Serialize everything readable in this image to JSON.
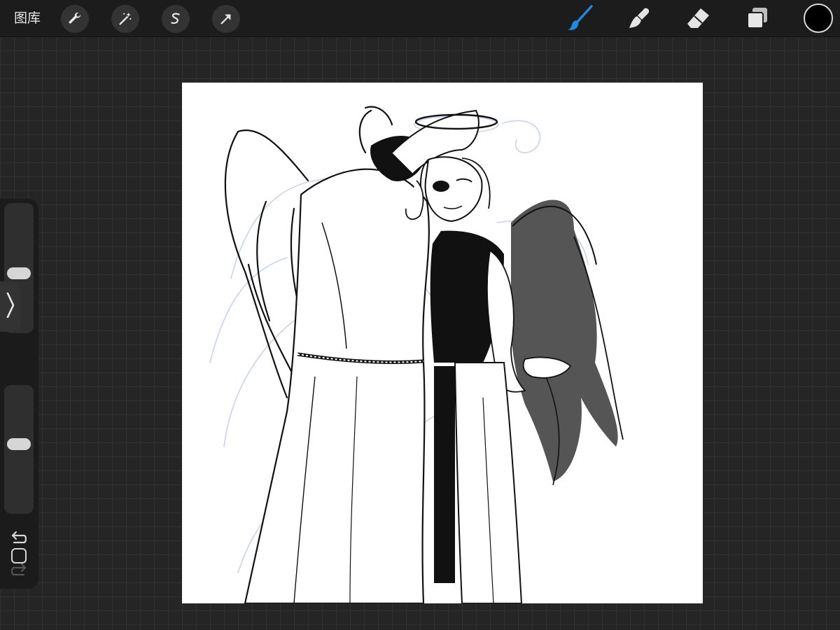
{
  "topbar": {
    "gallery_label": "图库",
    "left_tools": [
      "wrench-icon",
      "magic-wand-icon",
      "selection-s-icon",
      "transform-arrow-icon"
    ],
    "right_tools": [
      "brush-icon",
      "smudge-icon",
      "eraser-icon",
      "layers-icon"
    ],
    "active_tool": "brush-icon",
    "current_color": "#000000"
  },
  "sidebar": {
    "brush_size_slider": {
      "value": 0.45
    },
    "opacity_slider": {
      "value": 0.55
    },
    "controls": [
      "sidebar-toggle-icon",
      "modify-square-icon",
      "undo-icon",
      "redo-icon"
    ]
  },
  "colors": {
    "accent": "#1e88e5",
    "panel": "#1c1c1c",
    "background": "#252525",
    "sketch_line": "#c7d3ee",
    "wing_fill": "#555555"
  }
}
